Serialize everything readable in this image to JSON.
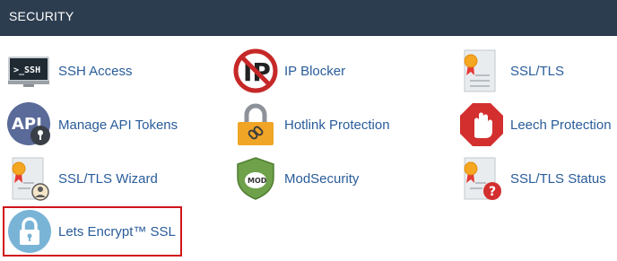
{
  "section": {
    "title": "SECURITY"
  },
  "items": [
    {
      "label": "SSH Access",
      "icon": "terminal-icon"
    },
    {
      "label": "IP Blocker",
      "icon": "ip-blocker-icon"
    },
    {
      "label": "SSL/TLS",
      "icon": "certificate-icon"
    },
    {
      "label": "Manage API Tokens",
      "icon": "api-token-icon"
    },
    {
      "label": "Hotlink Protection",
      "icon": "padlock-link-icon"
    },
    {
      "label": "Leech Protection",
      "icon": "stop-hand-icon"
    },
    {
      "label": "SSL/TLS Wizard",
      "icon": "certificate-wizard-icon"
    },
    {
      "label": "ModSecurity",
      "icon": "shield-icon"
    },
    {
      "label": "SSL/TLS Status",
      "icon": "certificate-status-icon"
    },
    {
      "label": "Lets Encrypt™ SSL",
      "icon": "padlock-icon"
    }
  ],
  "colors": {
    "header_bg": "#2d3d50",
    "link": "#295c9a",
    "highlight_border": "#d0141a"
  }
}
